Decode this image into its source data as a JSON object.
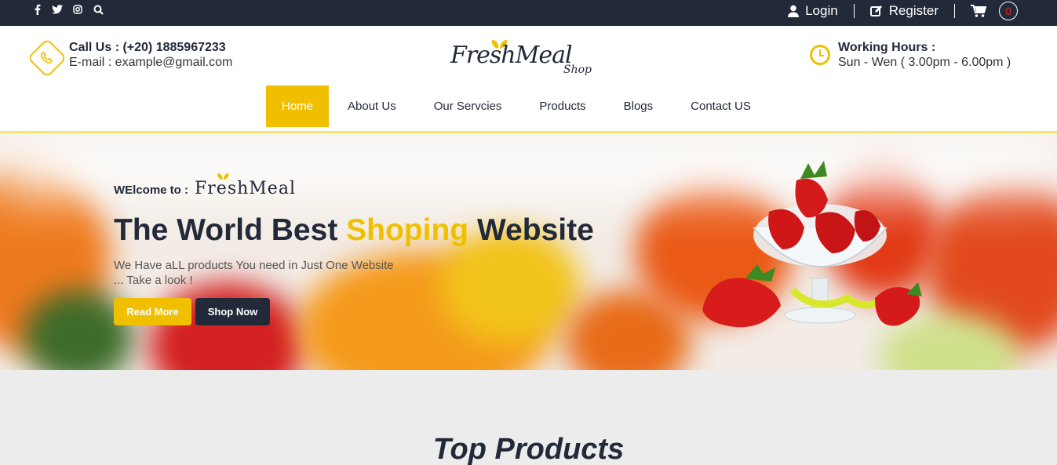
{
  "topbar": {
    "social_icons": [
      "facebook-icon",
      "twitter-icon",
      "instagram-icon",
      "search-icon"
    ],
    "login_label": "Login",
    "register_label": "Register",
    "cart_count": "0"
  },
  "header": {
    "call_title": "Call Us : (+20) 1885967233",
    "email": "E-mail : example@gmail.com",
    "logo_text": "FreshMeal",
    "logo_sub": "Shop",
    "hours_title": "Working Hours :",
    "hours_value": "Sun - Wen ( 3.00pm - 6.00pm )"
  },
  "nav": {
    "items": [
      "Home",
      "About Us",
      "Our Servcies",
      "Products",
      "Blogs",
      "Contact US"
    ],
    "active": "Home"
  },
  "hero": {
    "welcome": "WElcome to :",
    "brand": "FreshMeal",
    "headline_part1": "The World Best ",
    "headline_highlight": "Shoping",
    "headline_part2": " Website",
    "sub_line1": "We Have aLL products You need in Just One Website",
    "sub_line2": "... Take a look !",
    "read_more": "Read More",
    "shop_now": "Shop Now"
  },
  "section": {
    "title": "Top Products"
  },
  "colors": {
    "accent": "#f0c000",
    "dark": "#222a3a"
  }
}
